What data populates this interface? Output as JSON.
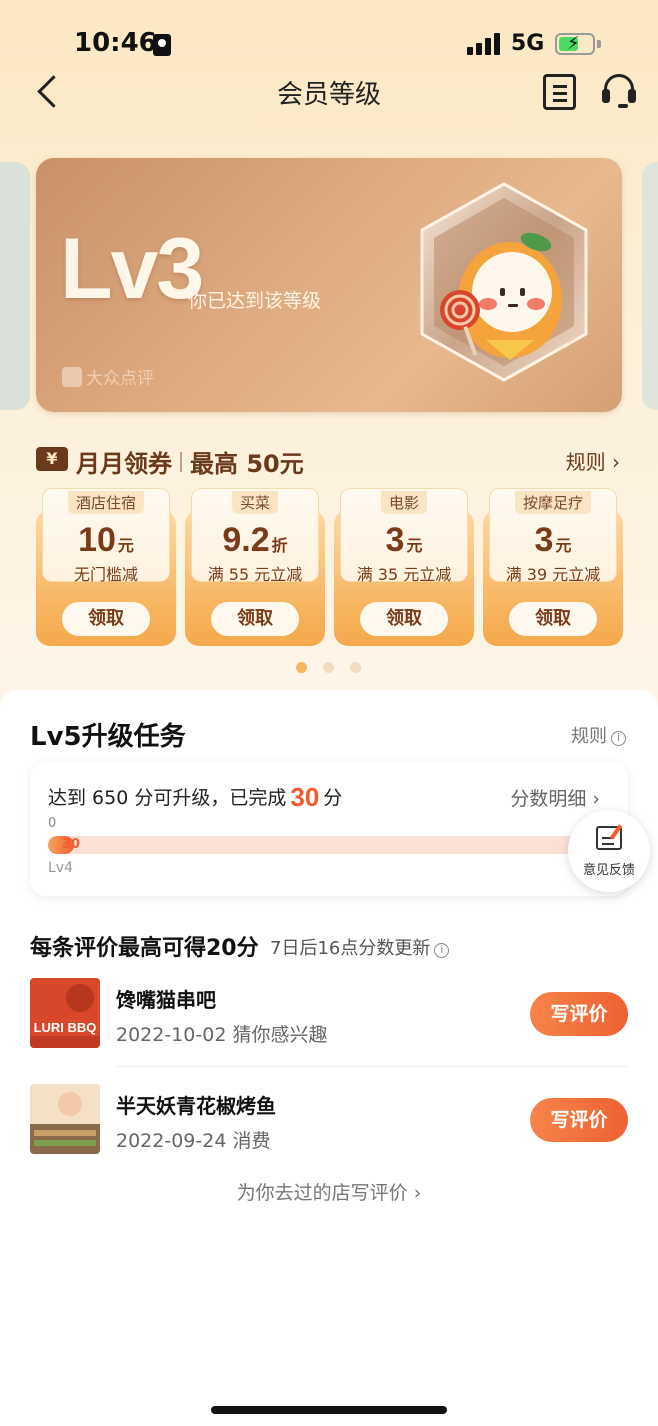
{
  "status_bar": {
    "time": "10:46",
    "network": "5G",
    "battery_level": 0.6
  },
  "nav": {
    "title": "会员等级"
  },
  "level_card": {
    "level": "Lv3",
    "status": "你已达到该等级",
    "brand": "大众点评"
  },
  "coupons": {
    "icon_symbol": "¥",
    "title": "月月领券",
    "max": "最高 50元",
    "rules": "规则 ›",
    "items": [
      {
        "category": "酒店住宿",
        "value": "10",
        "unit": "元",
        "condition": "无门槛减",
        "button": "领取"
      },
      {
        "category": "买菜",
        "value": "9.2",
        "unit": "折",
        "condition": "满 55 元立减",
        "button": "领取"
      },
      {
        "category": "电影",
        "value": "3",
        "unit": "元",
        "condition": "满 35 元立减",
        "button": "领取"
      },
      {
        "category": "按摩足疗",
        "value": "3",
        "unit": "元",
        "condition": "满 39 元立减",
        "button": "领取"
      }
    ],
    "pager": {
      "count": 3,
      "active": 0
    }
  },
  "task": {
    "title": "Lv5升级任务",
    "rules": "规则",
    "progress_prefix": "达到 650 分可升级，已完成",
    "points": "30",
    "points_suffix": "分",
    "detail": "分数明细 ›",
    "start": "0",
    "current_label": "30",
    "current_fraction": 0.046,
    "level_label": "Lv4"
  },
  "feedback": {
    "label": "意见反馈"
  },
  "reviews": {
    "title": "每条评价最高可得20分",
    "subtitle": "7日后16点分数更新",
    "shops": [
      {
        "name": "馋嘴猫串吧",
        "meta": "2022-10-02 猜你感兴趣",
        "button": "写评价",
        "thumb_text": "LURI BBQ"
      },
      {
        "name": "半天妖青花椒烤鱼",
        "meta": "2022-09-24 消费",
        "button": "写评价"
      }
    ],
    "footer": "为你去过的店写评价 ›"
  },
  "colors": {
    "accent": "#f55a2c",
    "brown": "#6b3a1d",
    "card": "#dfab80"
  }
}
